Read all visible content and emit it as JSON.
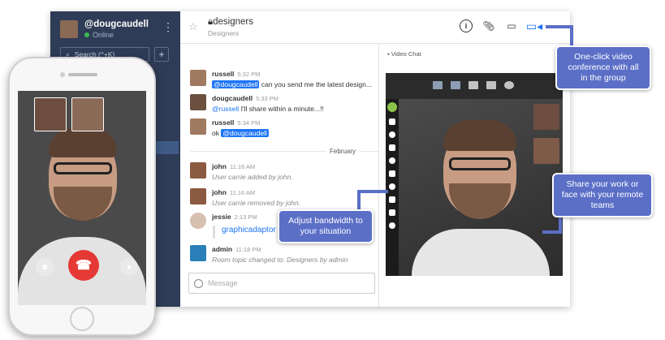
{
  "sidebar": {
    "username": "@dougcaudell",
    "status": "Online",
    "search_placeholder": "Search (^+K)",
    "add_label": "+"
  },
  "header": {
    "room_name": "designers",
    "room_subtitle": "Designers"
  },
  "messages": [
    {
      "user": "russell",
      "time": "5:32 PM",
      "mention": "@dougcaudell",
      "text": " can you send me the latest design..."
    },
    {
      "user": "dougcaudell",
      "time": "5:33 PM",
      "mention": "@russell",
      "text": " I'll share within a minute...!!"
    },
    {
      "user": "russell",
      "time": "5:34 PM",
      "prefix": "ok ",
      "mention": "@dougcaudell"
    },
    {
      "user": "john",
      "time": "11:16 AM",
      "system": "User carrie added by john."
    },
    {
      "user": "john",
      "time": "11:16 AM",
      "system": "User carrie removed by john."
    },
    {
      "user": "jessie",
      "time": "2:13 PM"
    },
    {
      "user": "admin",
      "time": "11:18 PM",
      "system": "Room topic changed to: Designers by admin"
    }
  ],
  "day_divider": "February",
  "file_link": "graphicadaptor",
  "composer_placeholder": "Message",
  "video_panel": {
    "title": "Video Chat"
  },
  "callouts": {
    "video": "One-click video conference with all in the group",
    "bandwidth": "Adjust bandwidth to your situation",
    "share": "Share your work or face with your remote teams"
  },
  "icons": {
    "star": "star-icon",
    "lock": "lock-icon",
    "info": "info-icon",
    "attach": "paperclip-icon",
    "file": "file-icon",
    "video": "video-icon",
    "hangup": "phone-hangup-icon"
  },
  "colors": {
    "sidebar": "#2f3c57",
    "accent": "#1d74f5",
    "callout": "#5b6fc7",
    "hangup": "#e53935"
  }
}
